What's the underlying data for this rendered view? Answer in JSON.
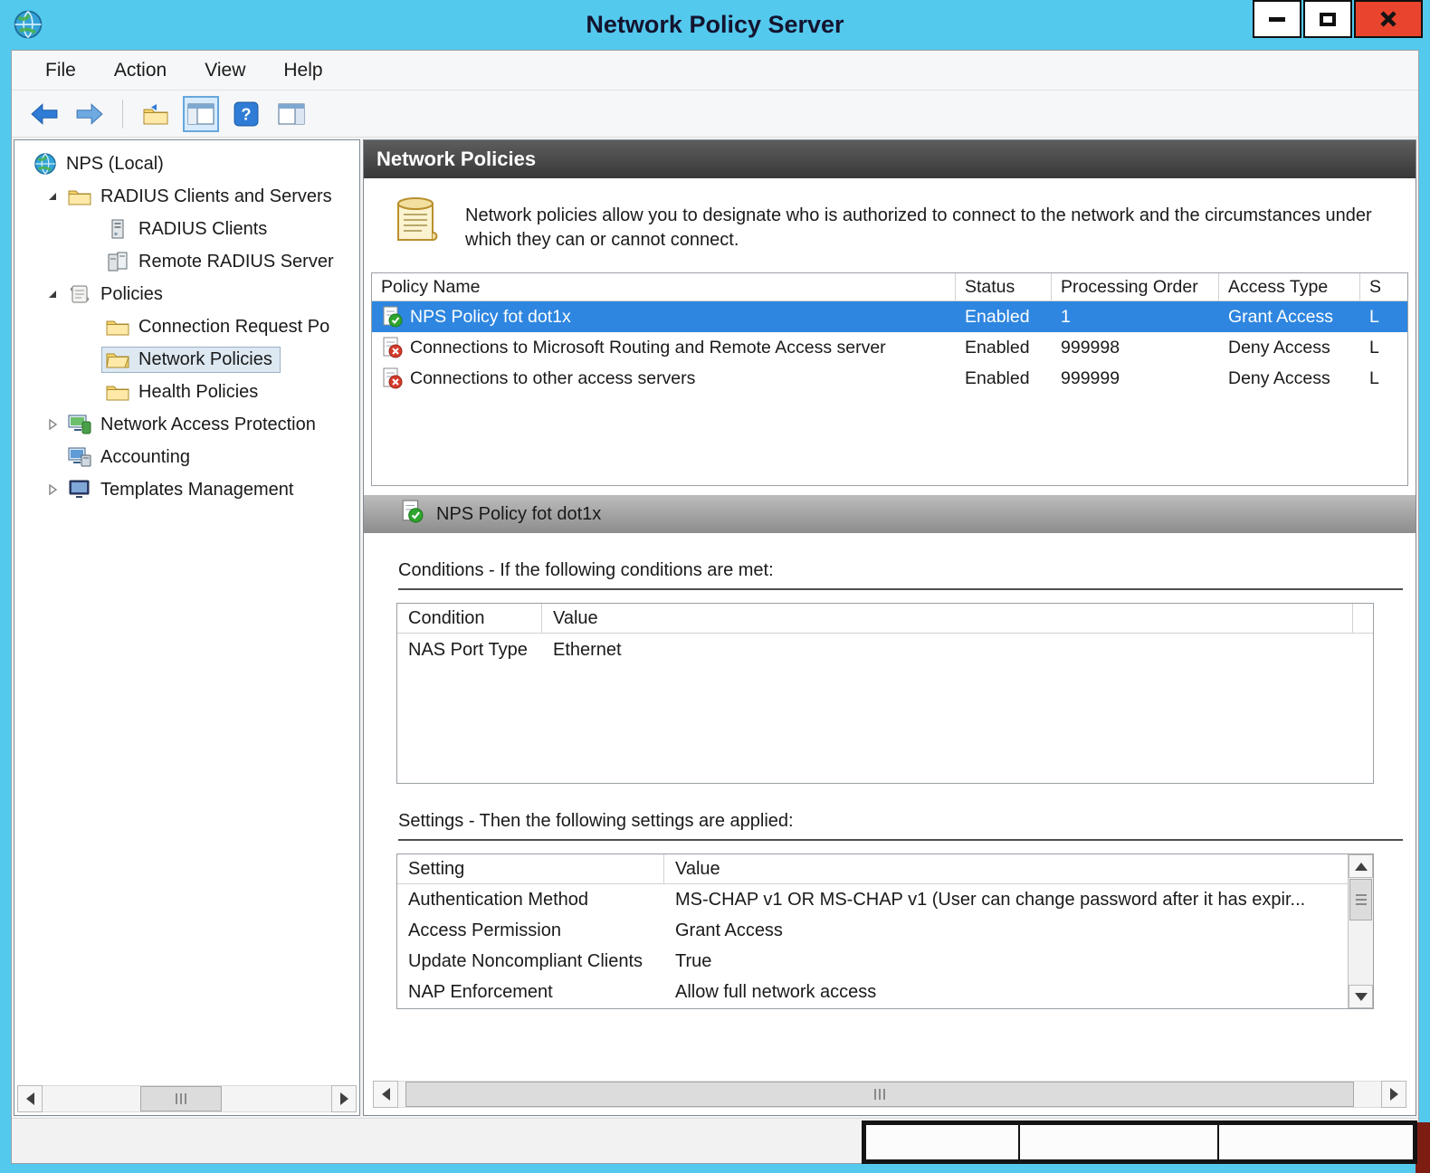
{
  "window": {
    "title": "Network Policy Server"
  },
  "menu": {
    "items": [
      "File",
      "Action",
      "View",
      "Help"
    ]
  },
  "toolbar": {
    "icons": [
      "back-icon",
      "forward-icon",
      "folder-arrow-icon",
      "console-tree-icon",
      "help-icon",
      "action-pane-icon"
    ]
  },
  "tree": {
    "items": [
      {
        "label": "NPS (Local)",
        "icon": "globe-icon"
      },
      {
        "label": "RADIUS Clients and Servers",
        "icon": "folder-icon"
      },
      {
        "label": "RADIUS Clients",
        "icon": "server-icon"
      },
      {
        "label": "Remote RADIUS Server",
        "icon": "servers-icon"
      },
      {
        "label": "Policies",
        "icon": "scroll-icon"
      },
      {
        "label": "Connection Request Po",
        "icon": "folder-icon"
      },
      {
        "label": "Network Policies",
        "icon": "folder-icon"
      },
      {
        "label": "Health Policies",
        "icon": "folder-icon"
      },
      {
        "label": "Network Access Protection",
        "icon": "nap-icon"
      },
      {
        "label": "Accounting",
        "icon": "accounting-icon"
      },
      {
        "label": "Templates Management",
        "icon": "templates-icon"
      }
    ]
  },
  "main": {
    "header": "Network Policies",
    "description": "Network policies allow you to designate who is authorized to connect to the network and the circumstances under which they can or cannot connect.",
    "policies": {
      "columns": {
        "name": "Policy Name",
        "status": "Status",
        "order": "Processing Order",
        "access": "Access Type",
        "source": "S"
      },
      "rows": [
        {
          "name": "NPS Policy fot dot1x",
          "status": "Enabled",
          "order": "1",
          "access": "Grant Access",
          "source": "L"
        },
        {
          "name": "Connections to Microsoft Routing and Remote Access server",
          "status": "Enabled",
          "order": "999998",
          "access": "Deny Access",
          "source": "L"
        },
        {
          "name": "Connections to other access servers",
          "status": "Enabled",
          "order": "999999",
          "access": "Deny Access",
          "source": "L"
        }
      ]
    },
    "detail": {
      "title": "NPS Policy fot dot1x"
    },
    "conditions": {
      "title": "Conditions - If the following conditions are met:",
      "columns": {
        "condition": "Condition",
        "value": "Value"
      },
      "rows": [
        {
          "condition": "NAS Port Type",
          "value": "Ethernet"
        }
      ]
    },
    "settings": {
      "title": "Settings - Then the following settings are applied:",
      "columns": {
        "setting": "Setting",
        "value": "Value"
      },
      "rows": [
        {
          "setting": "Authentication Method",
          "value": "MS-CHAP v1 OR MS-CHAP v1 (User can change password after it has expir..."
        },
        {
          "setting": "Access Permission",
          "value": "Grant Access"
        },
        {
          "setting": "Update Noncompliant Clients",
          "value": "True"
        },
        {
          "setting": "NAP Enforcement",
          "value": "Allow full network access"
        }
      ]
    }
  },
  "colors": {
    "titlebar": "#54c9ee",
    "selection_blue": "#2e86e0",
    "close_red": "#e8442e"
  }
}
